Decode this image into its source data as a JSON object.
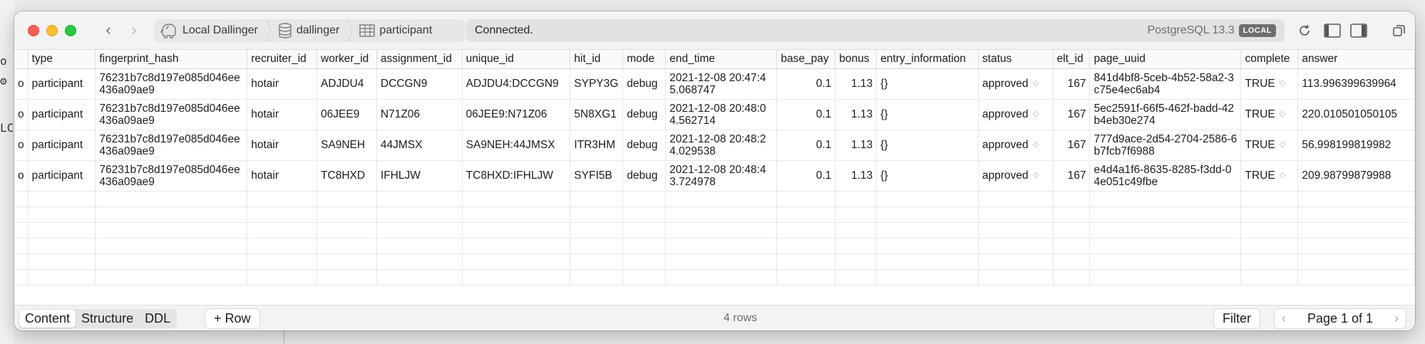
{
  "background": {
    "fragments": [
      "o",
      "o",
      "o",
      "o"
    ],
    "gear_fragment": "⚙",
    "lc_fragment": "LC"
  },
  "toolbar": {
    "crumbs": [
      {
        "label": "Local Dallinger",
        "icon": "elephant-icon"
      },
      {
        "label": "dallinger",
        "icon": "database-icon"
      },
      {
        "label": "participant",
        "icon": "table-icon"
      }
    ],
    "status": "Connected.",
    "server": "PostgreSQL 13.3",
    "badge": "LOCAL"
  },
  "table": {
    "columns": [
      "",
      "type",
      "fingerprint_hash",
      "recruiter_id",
      "worker_id",
      "assignment_id",
      "unique_id",
      "hit_id",
      "mode",
      "end_time",
      "base_pay",
      "bonus",
      "entry_information",
      "status",
      "elt_id",
      "page_uuid",
      "complete",
      "answer"
    ],
    "rows": [
      [
        "o",
        "participant",
        "76231b7c8d197e085d046ee436a09ae9",
        "hotair",
        "ADJDU4",
        "DCCGN9",
        "ADJDU4:DCCGN9",
        "SYPY3G",
        "debug",
        "2021-12-08 20:47:45.068747",
        "0.1",
        "1.13",
        "{}",
        "approved",
        "167",
        "841d4bf8-5ceb-4b52-58a2-3c75e4ec6ab4",
        "TRUE",
        "113.996399639964"
      ],
      [
        "o",
        "participant",
        "76231b7c8d197e085d046ee436a09ae9",
        "hotair",
        "06JEE9",
        "N71Z06",
        "06JEE9:N71Z06",
        "5N8XG1",
        "debug",
        "2021-12-08 20:48:04.562714",
        "0.1",
        "1.13",
        "{}",
        "approved",
        "167",
        "5ec2591f-66f5-462f-badd-42b4eb30e274",
        "TRUE",
        "220.010501050105"
      ],
      [
        "o",
        "participant",
        "76231b7c8d197e085d046ee436a09ae9",
        "hotair",
        "SA9NEH",
        "44JMSX",
        "SA9NEH:44JMSX",
        "ITR3HM",
        "debug",
        "2021-12-08 20:48:24.029538",
        "0.1",
        "1.13",
        "{}",
        "approved",
        "167",
        "777d9ace-2d54-2704-2586-6b7fcb7f6988",
        "TRUE",
        "56.998199819982"
      ],
      [
        "o",
        "participant",
        "76231b7c8d197e085d046ee436a09ae9",
        "hotair",
        "TC8HXD",
        "IFHLJW",
        "TC8HXD:IFHLJW",
        "SYFI5B",
        "debug",
        "2021-12-08 20:48:43.724978",
        "0.1",
        "1.13",
        "{}",
        "approved",
        "167",
        "e4d4a1f6-8635-8285-f3dd-04e051c49fbe",
        "TRUE",
        "209.98799879988"
      ]
    ]
  },
  "bottom": {
    "tabs": [
      "Content",
      "Structure",
      "DDL"
    ],
    "active_tab": "Content",
    "row_button": "+ Row",
    "row_count": "4 rows",
    "filter": "Filter",
    "page": "Page 1 of 1"
  }
}
